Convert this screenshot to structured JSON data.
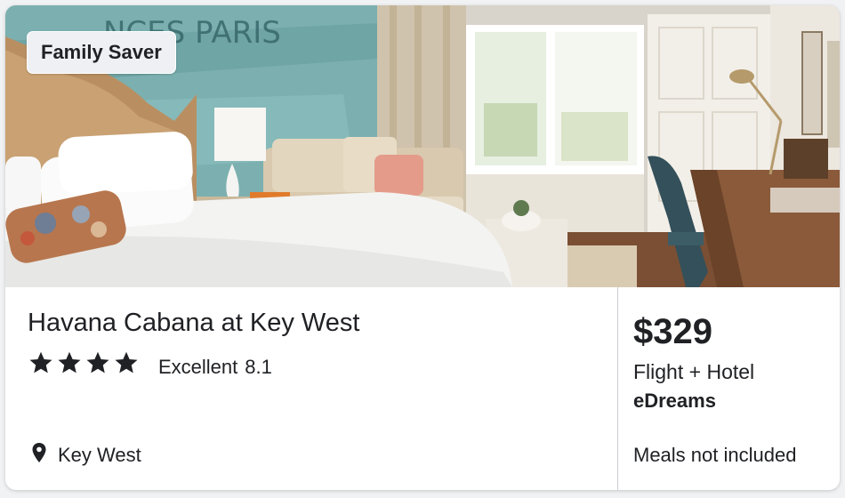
{
  "listing": {
    "badge": "Family Saver",
    "hotel_name": "Havana Cabana at Key West",
    "star_rating": 4,
    "rating_label": "Excellent",
    "rating_score": "8.1",
    "location": "Key West",
    "price": "$329",
    "package": "Flight + Hotel",
    "provider": "eDreams",
    "meals": "Meals not included"
  },
  "icons": {
    "star": "star-icon",
    "pin": "map-pin-icon"
  },
  "colors": {
    "text": "#202124",
    "badge_bg": "#eef0f3",
    "divider": "#c9cdd2"
  }
}
